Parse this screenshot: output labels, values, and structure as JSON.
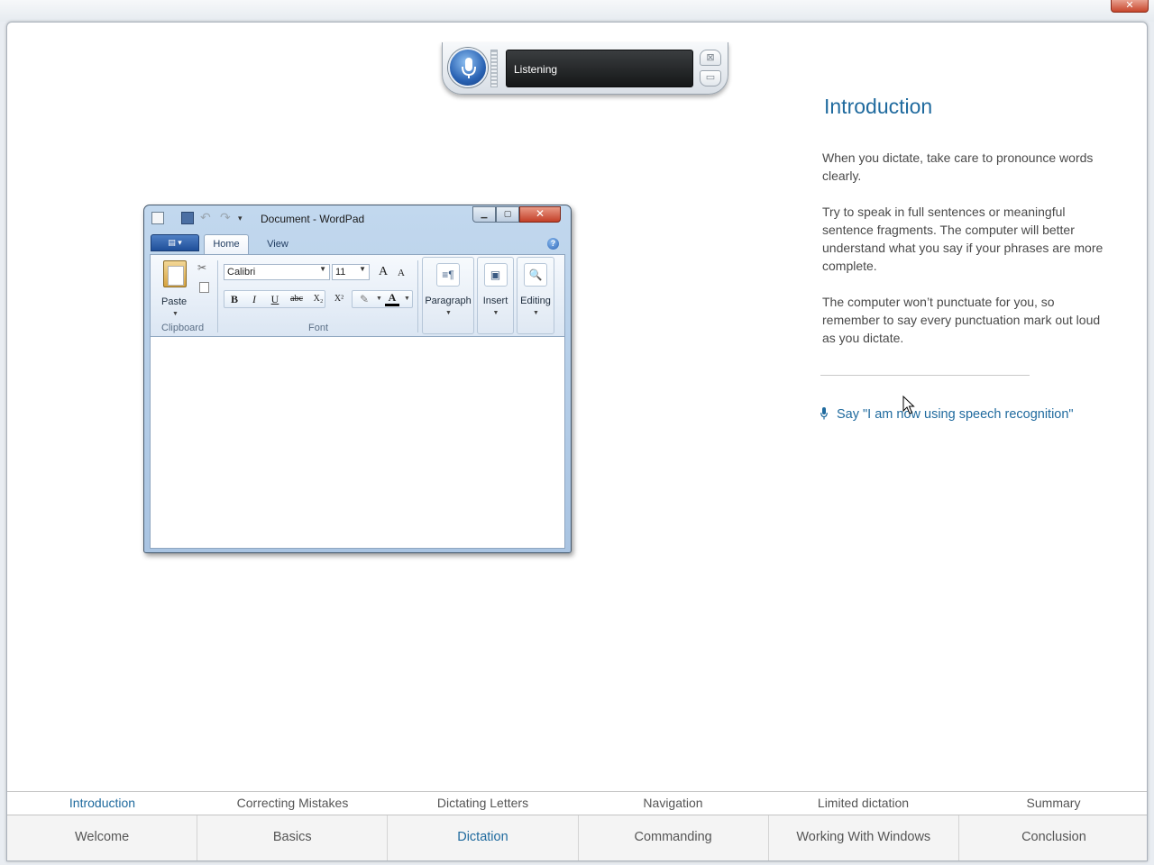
{
  "window": {
    "close_label": "✕"
  },
  "speech_bar": {
    "status": "Listening",
    "close_glyph": "⊠",
    "min_glyph": "▭"
  },
  "content": {
    "title": "Introduction",
    "paragraphs": [
      "When you dictate, take care to pronounce words clearly.",
      "Try to speak in full sentences or meaningful sentence fragments. The computer will better understand what you say if your phrases are more complete.",
      "The computer won’t punctuate for you, so remember to say every punctuation mark out loud as you dictate."
    ],
    "prompt": "Say \"I am now using speech recognition\""
  },
  "wordpad": {
    "title": "Document - WordPad",
    "tabs": [
      "Home",
      "View"
    ],
    "help": "?",
    "clipboard": {
      "paste": "Paste",
      "label": "Clipboard"
    },
    "font": {
      "family": "Calibri",
      "size": "11",
      "label": "Font",
      "grow": "A",
      "shrink": "A",
      "bold": "B",
      "italic": "I",
      "underline": "U",
      "strike": "abc",
      "subscript": "X₂",
      "superscript": "X²",
      "color": "A"
    },
    "groups": [
      {
        "label": "Paragraph",
        "icon": "≡¶"
      },
      {
        "label": "Insert",
        "icon": "▣"
      },
      {
        "label": "Editing",
        "icon": "🔍"
      }
    ]
  },
  "subnav": {
    "items": [
      "Introduction",
      "Correcting Mistakes",
      "Dictating Letters",
      "Navigation",
      "Limited dictation",
      "Summary"
    ],
    "active": 0
  },
  "mainnav": {
    "items": [
      "Welcome",
      "Basics",
      "Dictation",
      "Commanding",
      "Working With Windows",
      "Conclusion"
    ],
    "active": 2
  },
  "colors": {
    "accent": "#1f6a9e",
    "text": "#4a4a4a"
  }
}
